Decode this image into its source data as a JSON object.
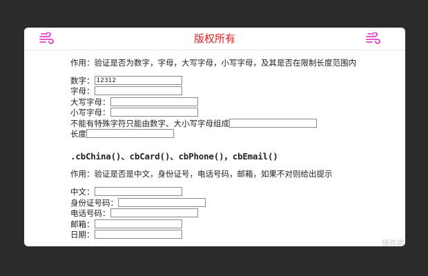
{
  "header": {
    "title": "版权所有",
    "left_icon": "wind-icon",
    "right_icon": "wind-icon",
    "accent": "#e02020"
  },
  "section1": {
    "description": "作用：验证是否为数字，字母，大写字母，小写字母，及其是否在限制长度范围内",
    "fields": [
      {
        "label": "数字：",
        "value": "12312"
      },
      {
        "label": "字母：",
        "value": ""
      },
      {
        "label": "大写字母：",
        "value": ""
      },
      {
        "label": "小写字母：",
        "value": ""
      },
      {
        "label": "不能有特殊字符只能由数字、大小写字母组成",
        "value": ""
      },
      {
        "label": "长度",
        "value": ""
      }
    ]
  },
  "section2": {
    "title": ".cbChina()、cbCard()、cbPhone()，cbEmail()",
    "description": "作用：验证是否是中文，身份证号，电话号码，邮箱，如果不对则给出提示",
    "fields": [
      {
        "label": "中文：",
        "value": ""
      },
      {
        "label": "身份证号码：",
        "value": ""
      },
      {
        "label": "电话号码：",
        "value": ""
      },
      {
        "label": "邮箱：",
        "value": ""
      },
      {
        "label": "日期：",
        "value": ""
      }
    ]
  },
  "watermark": {
    "text": "jQuery",
    "subtext": "插件库"
  }
}
